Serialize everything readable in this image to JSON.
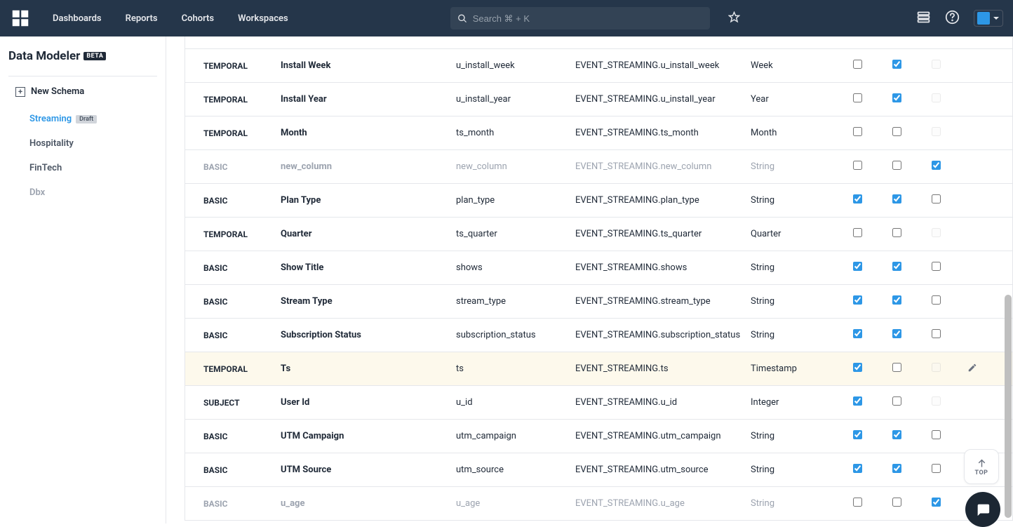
{
  "nav": {
    "links": [
      "Dashboards",
      "Reports",
      "Cohorts",
      "Workspaces"
    ],
    "search_placeholder": "Search ⌘ + K"
  },
  "sidebar": {
    "page_title": "Data Modeler",
    "beta_label": "BETA",
    "new_schema_label": "New Schema",
    "items": [
      {
        "label": "Streaming",
        "badge": "Draft",
        "active": true
      },
      {
        "label": "Hospitality"
      },
      {
        "label": "FinTech"
      },
      {
        "label": "Dbx",
        "muted": true
      }
    ]
  },
  "rows": [
    {
      "type": "TEMPORAL",
      "name": "Install Week",
      "id": "u_install_week",
      "path": "EVENT_STREAMING.u_install_week",
      "dtype": "Week",
      "c1": false,
      "c2": true,
      "c3": false,
      "c3_disabled": true,
      "partial_first": false
    },
    {
      "type": "TEMPORAL",
      "name": "Install Year",
      "id": "u_install_year",
      "path": "EVENT_STREAMING.u_install_year",
      "dtype": "Year",
      "c1": false,
      "c2": true,
      "c3": false,
      "c3_disabled": true
    },
    {
      "type": "TEMPORAL",
      "name": "Month",
      "id": "ts_month",
      "path": "EVENT_STREAMING.ts_month",
      "dtype": "Month",
      "c1": false,
      "c2": false,
      "c3": false,
      "c3_disabled": true
    },
    {
      "type": "BASIC",
      "name": "new_column",
      "id": "new_column",
      "path": "EVENT_STREAMING.new_column",
      "dtype": "String",
      "c1": false,
      "c2": false,
      "c3": true,
      "muted": true
    },
    {
      "type": "BASIC",
      "name": "Plan Type",
      "id": "plan_type",
      "path": "EVENT_STREAMING.plan_type",
      "dtype": "String",
      "c1": true,
      "c2": true,
      "c3": false
    },
    {
      "type": "TEMPORAL",
      "name": "Quarter",
      "id": "ts_quarter",
      "path": "EVENT_STREAMING.ts_quarter",
      "dtype": "Quarter",
      "c1": false,
      "c2": false,
      "c3": false,
      "c3_disabled": true
    },
    {
      "type": "BASIC",
      "name": "Show Title",
      "id": "shows",
      "path": "EVENT_STREAMING.shows",
      "dtype": "String",
      "c1": true,
      "c2": true,
      "c3": false
    },
    {
      "type": "BASIC",
      "name": "Stream Type",
      "id": "stream_type",
      "path": "EVENT_STREAMING.stream_type",
      "dtype": "String",
      "c1": true,
      "c2": true,
      "c3": false
    },
    {
      "type": "BASIC",
      "name": "Subscription Status",
      "id": "subscription_status",
      "path": "EVENT_STREAMING.subscription_status",
      "dtype": "String",
      "c1": true,
      "c2": true,
      "c3": false
    },
    {
      "type": "TEMPORAL",
      "name": "Ts",
      "id": "ts",
      "path": "EVENT_STREAMING.ts",
      "dtype": "Timestamp",
      "c1": true,
      "c2": false,
      "c3": false,
      "c3_disabled": true,
      "highlight": true,
      "edit": true
    },
    {
      "type": "SUBJECT",
      "name": "User Id",
      "id": "u_id",
      "path": "EVENT_STREAMING.u_id",
      "dtype": "Integer",
      "c1": true,
      "c2": false,
      "c3": false,
      "c3_disabled": true
    },
    {
      "type": "BASIC",
      "name": "UTM Campaign",
      "id": "utm_campaign",
      "path": "EVENT_STREAMING.utm_campaign",
      "dtype": "String",
      "c1": true,
      "c2": true,
      "c3": false
    },
    {
      "type": "BASIC",
      "name": "UTM Source",
      "id": "utm_source",
      "path": "EVENT_STREAMING.utm_source",
      "dtype": "String",
      "c1": true,
      "c2": true,
      "c3": false
    },
    {
      "type": "BASIC",
      "name": "u_age",
      "id": "u_age",
      "path": "EVENT_STREAMING.u_age",
      "dtype": "String",
      "c1": false,
      "c2": false,
      "c3": true,
      "muted": true
    }
  ],
  "scroll_top_label": "TOP"
}
